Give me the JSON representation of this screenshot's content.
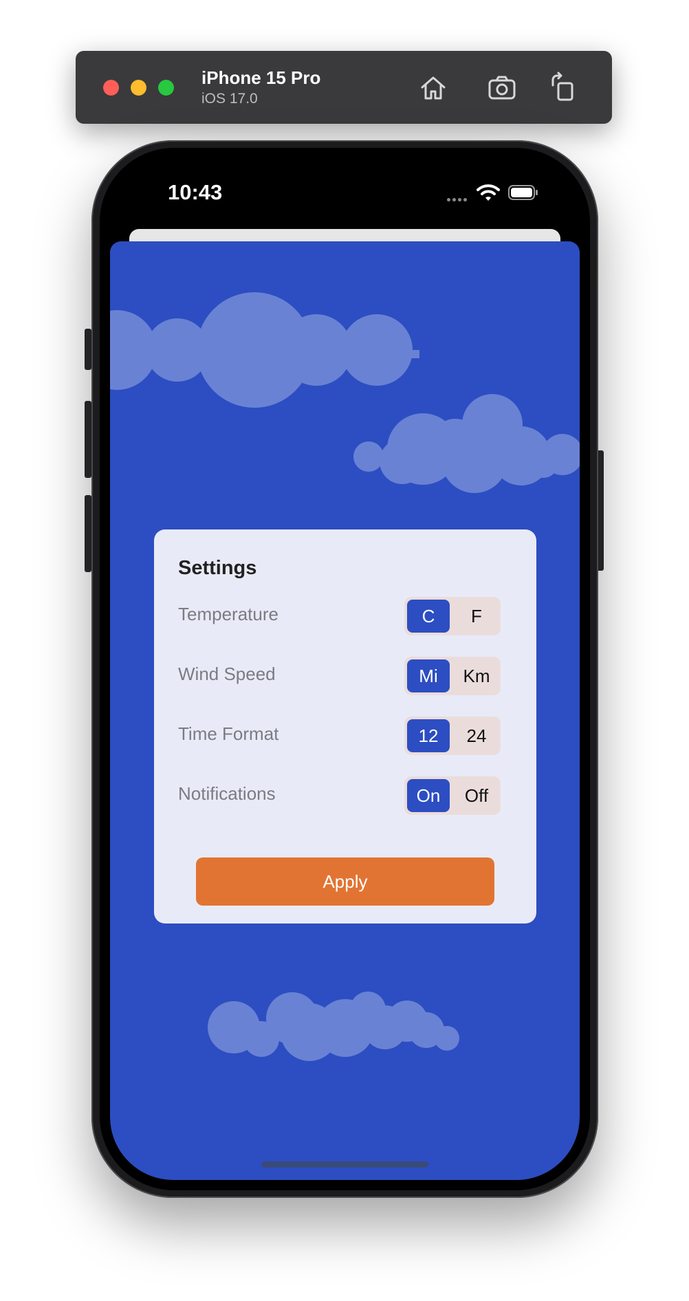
{
  "simulator": {
    "device_name": "iPhone 15 Pro",
    "os_version": "iOS 17.0",
    "toolbar_icons": [
      "home-icon",
      "screenshot-icon",
      "rotate-icon"
    ]
  },
  "status_bar": {
    "time": "10:43"
  },
  "settings": {
    "title": "Settings",
    "rows": [
      {
        "label": "Temperature",
        "options": [
          "C",
          "F"
        ],
        "selected": "C"
      },
      {
        "label": "Wind Speed",
        "options": [
          "Mi",
          "Km"
        ],
        "selected": "Mi"
      },
      {
        "label": "Time Format",
        "options": [
          "12",
          "24"
        ],
        "selected": "12"
      },
      {
        "label": "Notifications",
        "options": [
          "On",
          "Off"
        ],
        "selected": "On"
      }
    ],
    "apply_label": "Apply"
  },
  "colors": {
    "background": "#2c4ec2",
    "accent": "#2c4ec2",
    "apply_button": "#e27433",
    "card": "#e8ebf7"
  }
}
